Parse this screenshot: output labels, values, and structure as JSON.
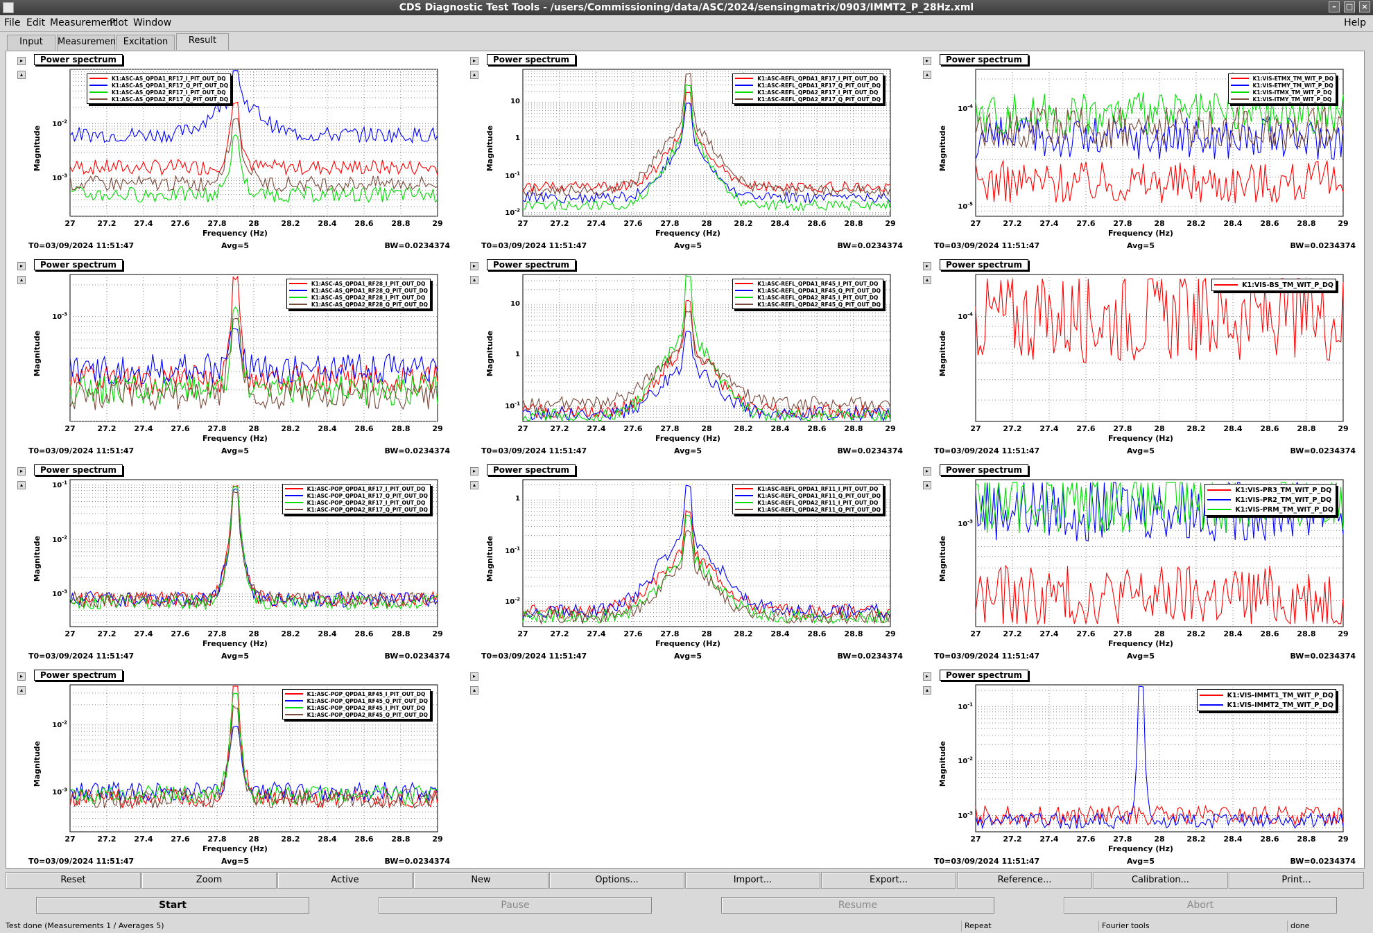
{
  "window": {
    "title": "CDS Diagnostic Test Tools - /users/Commissioning/data/ASC/2024/sensingmatrix/0903/IMMT2_P_28Hz.xml",
    "help": "Help"
  },
  "menu": [
    "File",
    "Edit",
    "Measurement",
    "Plot",
    "Window"
  ],
  "tabs": [
    "Input",
    "Measurement",
    "Excitation",
    "Result"
  ],
  "common": {
    "panel_title": "Power spectrum",
    "ylabel": "Magnitude",
    "xlabel": "Frequency (Hz)",
    "t0": "T0=03/09/2024 11:51:47",
    "avg": "Avg=5",
    "bw": "BW=0.0234374",
    "xticks": [
      "27",
      "27.2",
      "27.4",
      "27.6",
      "27.8",
      "28",
      "28.2",
      "28.4",
      "28.6",
      "28.8",
      "29"
    ]
  },
  "colors": {
    "red": "#ff0000",
    "blue": "#0000ff",
    "green": "#00dd00",
    "brown": "#7a4a3a"
  },
  "chart_data": [
    {
      "type": "line",
      "title": "Power spectrum",
      "ylabel": "Magnitude",
      "xlabel": "Frequency (Hz)",
      "xlim": [
        27,
        29
      ],
      "scale": "log",
      "yticks": [
        "10^-2",
        "10^-3"
      ],
      "ylim_log": [
        -3.7,
        -1.0
      ],
      "series": [
        {
          "name": "K1:ASC-AS_QPDA1_RF17_I_PIT_OUT_DQ",
          "color": "red"
        },
        {
          "name": "K1:ASC-AS_QPDA1_RF17_Q_PIT_OUT_DQ",
          "color": "blue"
        },
        {
          "name": "K1:ASC-AS_QPDA2_RF17_I_PIT_OUT_DQ",
          "color": "green"
        },
        {
          "name": "K1:ASC-AS_QPDA2_RF17_Q_PIT_OUT_DQ",
          "color": "brown"
        }
      ],
      "peak": 27.9,
      "levels": [
        -2.8,
        -2.2,
        -3.3,
        -3.1
      ],
      "peaks": [
        -1.6,
        -1.0,
        -2.2,
        -1.9
      ],
      "widths": [
        0.08,
        0.25,
        0.08,
        0.12
      ]
    },
    {
      "type": "line",
      "title": "Power spectrum",
      "ylabel": "Magnitude",
      "xlabel": "Frequency (Hz)",
      "xlim": [
        27,
        29
      ],
      "scale": "log",
      "yticks": [
        "10",
        "1",
        "10^-1",
        "10^-2"
      ],
      "ylim_log": [
        -2.1,
        1.9
      ],
      "series": [
        {
          "name": "K1:ASC-REFL_QPDA1_RF17_I_PIT_OUT_DQ",
          "color": "red"
        },
        {
          "name": "K1:ASC-REFL_QPDA1_RF17_Q_PIT_OUT_DQ",
          "color": "blue"
        },
        {
          "name": "K1:ASC-REFL_QPDA2_RF17_I_PIT_OUT_DQ",
          "color": "green"
        },
        {
          "name": "K1:ASC-REFL_QPDA2_RF17_Q_PIT_OUT_DQ",
          "color": "brown"
        }
      ],
      "peak": 27.9,
      "levels": [
        -1.3,
        -1.6,
        -1.8,
        -1.4
      ],
      "peaks": [
        1.3,
        1.0,
        1.5,
        1.8
      ],
      "widths": [
        0.25,
        0.25,
        0.25,
        0.3
      ]
    },
    {
      "type": "line",
      "title": "Power spectrum",
      "ylabel": "Magnitude",
      "xlabel": "Frequency (Hz)",
      "xlim": [
        27,
        29
      ],
      "scale": "log",
      "yticks": [
        "10^-4",
        "10^-5"
      ],
      "ylim_log": [
        -5.1,
        -3.6
      ],
      "series": [
        {
          "name": "K1:VIS-ETMX_TM_WIT_P_DQ",
          "color": "red"
        },
        {
          "name": "K1:VIS-ETMY_TM_WIT_P_DQ",
          "color": "blue"
        },
        {
          "name": "K1:VIS-ITMX_TM_WIT_P_DQ",
          "color": "green"
        },
        {
          "name": "K1:VIS-ITMY_TM_WIT_P_DQ",
          "color": "brown"
        }
      ],
      "peak": null,
      "levels": [
        -4.75,
        -4.3,
        -4.05,
        -4.2
      ],
      "peaks": [
        0,
        0,
        0,
        0
      ],
      "widths": [
        0,
        0,
        0,
        0
      ]
    },
    {
      "type": "line",
      "title": "Power spectrum",
      "ylabel": "Magnitude",
      "xlabel": "Frequency (Hz)",
      "xlim": [
        27,
        29
      ],
      "scale": "log",
      "yticks": [
        "10^-3"
      ],
      "ylim_log": [
        -4.0,
        -2.6
      ],
      "series": [
        {
          "name": "K1:ASC-AS_QPDA1_RF28_I_PIT_OUT_DQ",
          "color": "red"
        },
        {
          "name": "K1:ASC-AS_QPDA1_RF28_Q_PIT_OUT_DQ",
          "color": "blue"
        },
        {
          "name": "K1:ASC-AS_QPDA2_RF28_I_PIT_OUT_DQ",
          "color": "green"
        },
        {
          "name": "K1:ASC-AS_QPDA2_RF28_Q_PIT_OUT_DQ",
          "color": "brown"
        }
      ],
      "peak": 27.9,
      "levels": [
        -3.6,
        -3.5,
        -3.7,
        -3.75
      ],
      "peaks": [
        -2.6,
        -3.1,
        -2.9,
        -3.0
      ],
      "widths": [
        0.06,
        0.06,
        0.06,
        0.08
      ]
    },
    {
      "type": "line",
      "title": "Power spectrum",
      "ylabel": "Magnitude",
      "xlabel": "Frequency (Hz)",
      "xlim": [
        27,
        29
      ],
      "scale": "log",
      "yticks": [
        "10",
        "1",
        "10^-1"
      ],
      "ylim_log": [
        -1.3,
        1.6
      ],
      "series": [
        {
          "name": "K1:ASC-REFL_QPDA1_RF45_I_PIT_OUT_DQ",
          "color": "red"
        },
        {
          "name": "K1:ASC-REFL_QPDA1_RF45_Q_PIT_OUT_DQ",
          "color": "blue"
        },
        {
          "name": "K1:ASC-REFL_QPDA2_RF45_I_PIT_OUT_DQ",
          "color": "green"
        },
        {
          "name": "K1:ASC-REFL_QPDA2_RF45_Q_PIT_OUT_DQ",
          "color": "brown"
        }
      ],
      "peak": 27.9,
      "levels": [
        -1.1,
        -1.15,
        -1.2,
        -0.95
      ],
      "peaks": [
        1.1,
        0.5,
        1.6,
        0.9
      ],
      "widths": [
        0.3,
        0.3,
        0.3,
        0.35
      ]
    },
    {
      "type": "line",
      "title": "Power spectrum",
      "ylabel": "Magnitude",
      "xlabel": "Frequency (Hz)",
      "xlim": [
        27,
        29
      ],
      "scale": "log",
      "yticks": [
        "10^-4"
      ],
      "ylim_log": [
        -4.5,
        -3.8
      ],
      "series": [
        {
          "name": "K1:VIS-BS_TM_WIT_P_DQ",
          "color": "red"
        }
      ],
      "peak": null,
      "levels": [
        -4.0
      ],
      "peaks": [
        0
      ],
      "widths": [
        0
      ]
    },
    {
      "type": "line",
      "title": "Power spectrum",
      "ylabel": "Magnitude",
      "xlabel": "Frequency (Hz)",
      "xlim": [
        27,
        29
      ],
      "scale": "log",
      "yticks": [
        "10^-1",
        "10^-2",
        "10^-3"
      ],
      "ylim_log": [
        -3.6,
        -0.9
      ],
      "series": [
        {
          "name": "K1:ASC-POP_QPDA1_RF17_I_PIT_OUT_DQ",
          "color": "red"
        },
        {
          "name": "K1:ASC-POP_QPDA1_RF17_Q_PIT_OUT_DQ",
          "color": "blue"
        },
        {
          "name": "K1:ASC-POP_QPDA2_RF17_I_PIT_OUT_DQ",
          "color": "green"
        },
        {
          "name": "K1:ASC-POP_QPDA2_RF17_Q_PIT_OUT_DQ",
          "color": "brown"
        }
      ],
      "peak": 27.9,
      "levels": [
        -3.1,
        -3.1,
        -3.15,
        -3.1
      ],
      "peaks": [
        -1.0,
        -1.05,
        -1.0,
        -1.1
      ],
      "widths": [
        0.1,
        0.1,
        0.1,
        0.1
      ]
    },
    {
      "type": "line",
      "title": "Power spectrum",
      "ylabel": "Magnitude",
      "xlabel": "Frequency (Hz)",
      "xlim": [
        27,
        29
      ],
      "scale": "log",
      "yticks": [
        "1",
        "10^-1",
        "10^-2"
      ],
      "ylim_log": [
        -2.5,
        0.4
      ],
      "series": [
        {
          "name": "K1:ASC-REFL_QPDA1_RF11_I_PIT_OUT_DQ",
          "color": "red"
        },
        {
          "name": "K1:ASC-REFL_QPDA1_RF11_Q_PIT_OUT_DQ",
          "color": "blue"
        },
        {
          "name": "K1:ASC-REFL_QPDA2_RF11_I_PIT_OUT_DQ",
          "color": "green"
        },
        {
          "name": "K1:ASC-REFL_QPDA2_RF11_Q_PIT_OUT_DQ",
          "color": "brown"
        }
      ],
      "peak": 27.9,
      "levels": [
        -2.2,
        -2.2,
        -2.3,
        -2.3
      ],
      "peaks": [
        -0.2,
        0.3,
        -0.3,
        -0.6
      ],
      "widths": [
        0.35,
        0.35,
        0.3,
        0.3
      ]
    },
    {
      "type": "line",
      "title": "Power spectrum",
      "ylabel": "Magnitude",
      "xlabel": "Frequency (Hz)",
      "xlim": [
        27,
        29
      ],
      "scale": "log",
      "yticks": [
        "10^-3"
      ],
      "ylim_log": [
        -3.7,
        -2.7
      ],
      "series": [
        {
          "name": "K1:VIS-PR3_TM_WIT_P_DQ",
          "color": "red"
        },
        {
          "name": "K1:VIS-PR2_TM_WIT_P_DQ",
          "color": "blue"
        },
        {
          "name": "K1:VIS-PRM_TM_WIT_P_DQ",
          "color": "green"
        }
      ],
      "peak": null,
      "levels": [
        -3.5,
        -2.9,
        -2.85
      ],
      "peaks": [
        0,
        0,
        0
      ],
      "widths": [
        0,
        0,
        0
      ]
    },
    {
      "type": "line",
      "title": "Power spectrum",
      "ylabel": "Magnitude",
      "xlabel": "Frequency (Hz)",
      "xlim": [
        27,
        29
      ],
      "scale": "log",
      "yticks": [
        "10^-2",
        "10^-3"
      ],
      "ylim_log": [
        -3.6,
        -1.4
      ],
      "series": [
        {
          "name": "K1:ASC-POP_QPDA1_RF45_I_PIT_OUT_DQ",
          "color": "red"
        },
        {
          "name": "K1:ASC-POP_QPDA1_RF45_Q_PIT_OUT_DQ",
          "color": "blue"
        },
        {
          "name": "K1:ASC-POP_QPDA2_RF45_I_PIT_OUT_DQ",
          "color": "green"
        },
        {
          "name": "K1:ASC-POP_QPDA2_RF45_Q_PIT_OUT_DQ",
          "color": "brown"
        }
      ],
      "peak": 27.9,
      "levels": [
        -3.1,
        -3.0,
        -3.05,
        -3.1
      ],
      "peaks": [
        -1.4,
        -2.0,
        -1.5,
        -1.7
      ],
      "widths": [
        0.08,
        0.08,
        0.08,
        0.08
      ]
    },
    null,
    {
      "type": "line",
      "title": "Power spectrum",
      "ylabel": "Magnitude",
      "xlabel": "Frequency (Hz)",
      "xlim": [
        27,
        29
      ],
      "scale": "log",
      "yticks": [
        "10^-1",
        "10^-2",
        "10^-3"
      ],
      "ylim_log": [
        -3.3,
        -0.6
      ],
      "series": [
        {
          "name": "K1:VIS-IMMT1_TM_WIT_P_DQ",
          "color": "red"
        },
        {
          "name": "K1:VIS-IMMT2_TM_WIT_P_DQ",
          "color": "blue"
        }
      ],
      "peak": 27.9,
      "levels": [
        -3.0,
        -3.1
      ],
      "peaks": [
        -3.0,
        -0.6
      ],
      "widths": [
        0,
        0.04
      ]
    }
  ],
  "toolbar": [
    "Reset",
    "Zoom",
    "Active",
    "New",
    "Options...",
    "Import...",
    "Export...",
    "Reference...",
    "Calibration...",
    "Print..."
  ],
  "controls": [
    "Start",
    "Pause",
    "Resume",
    "Abort"
  ],
  "status": {
    "message": "Test done (Measurements 1 / Averages 5)",
    "repeat": "Repeat",
    "tools": "Fourier tools",
    "state": "done"
  }
}
